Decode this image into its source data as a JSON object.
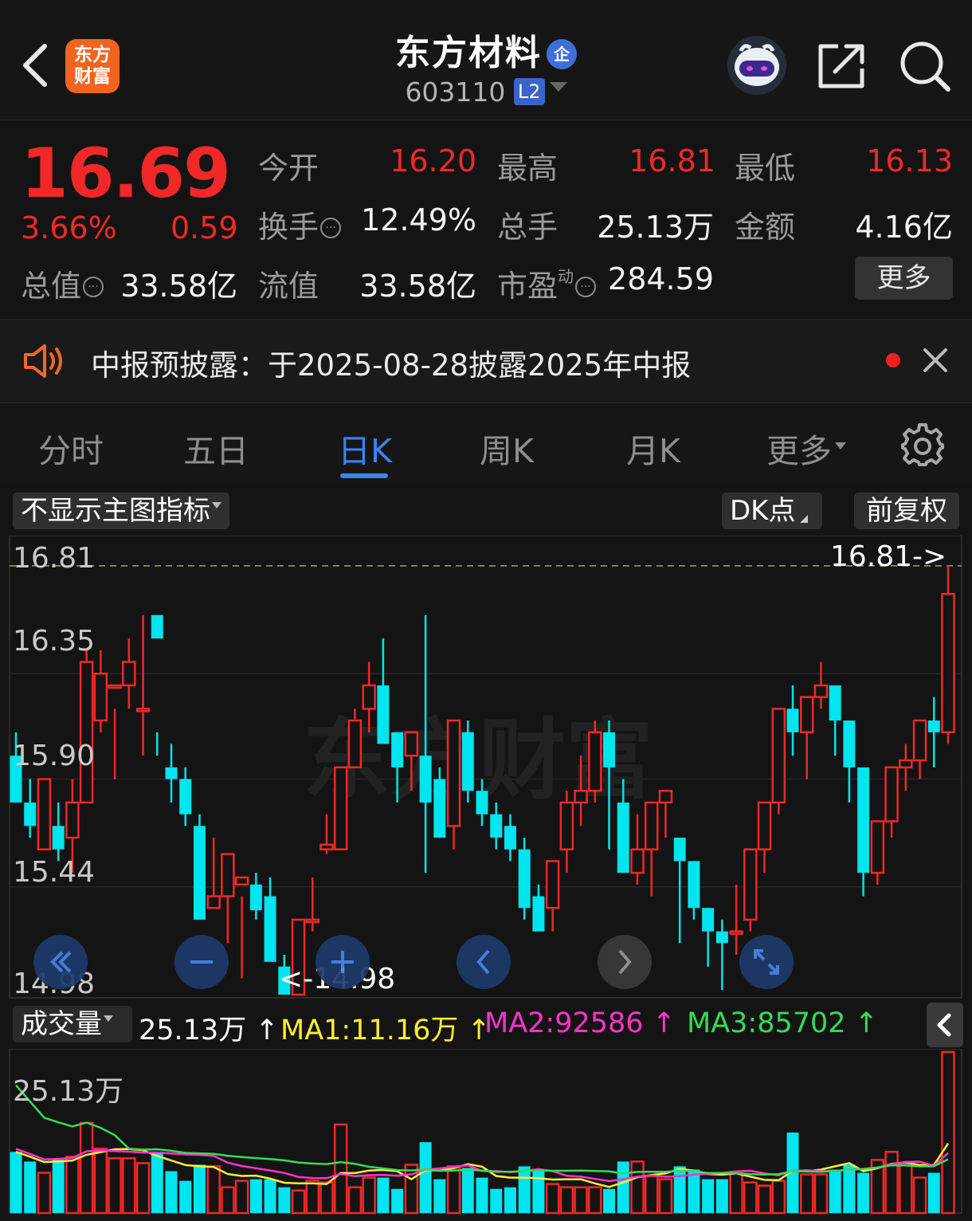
{
  "header": {
    "logo_line1": "东方",
    "logo_line2": "财富",
    "stock_name": "东方材料",
    "name_badge": "企",
    "stock_code": "603110",
    "level_badge": "L2"
  },
  "quote": {
    "price": "16.69",
    "change_pct": "3.66%",
    "change_amt": "0.59",
    "open_label": "今开",
    "open_value": "16.20",
    "high_label": "最高",
    "high_value": "16.81",
    "low_label": "最低",
    "low_value": "16.13",
    "turnover_label": "换手",
    "turnover_value": "12.49%",
    "volume_label": "总手",
    "volume_value": "25.13万",
    "amount_label": "金额",
    "amount_value": "4.16亿",
    "mcap_label": "总值",
    "mcap_value": "33.58亿",
    "float_label": "流值",
    "float_value": "33.58亿",
    "pe_label": "市盈",
    "pe_super": "动",
    "pe_value": "284.59",
    "more_label": "更多"
  },
  "notice": {
    "text": "中报预披露：于2025-08-28披露2025年中报"
  },
  "tabs": {
    "items": [
      "分时",
      "五日",
      "日K",
      "周K",
      "月K",
      "更多"
    ],
    "active": 2
  },
  "chart_controls": {
    "indicator_label": "不显示主图指标",
    "dk_label": "DK点",
    "adjust_label": "前复权"
  },
  "chart_data": {
    "type": "candlestick",
    "y_ticks": [
      "16.81",
      "16.35",
      "15.90",
      "15.44",
      "14.98"
    ],
    "ylim": [
      14.98,
      16.81
    ],
    "high_marker": "16.81->",
    "low_marker": "<-14.98",
    "watermark": "东方财富",
    "colors": {
      "up": "#f02828",
      "down": "#00e5ee",
      "ma1": "#ffee33",
      "ma2": "#ff33cc",
      "ma3": "#33dd55"
    },
    "candles": [
      [
        16.0,
        16.1,
        15.8,
        15.8
      ],
      [
        15.8,
        15.9,
        15.65,
        15.7
      ],
      [
        15.6,
        15.9,
        15.6,
        15.9
      ],
      [
        15.7,
        15.8,
        15.55,
        15.6
      ],
      [
        15.65,
        15.9,
        15.5,
        15.8
      ],
      [
        15.8,
        16.45,
        15.8,
        16.4
      ],
      [
        16.15,
        16.45,
        16.1,
        16.35
      ],
      [
        16.3,
        16.2,
        15.9,
        16.3
      ],
      [
        16.3,
        16.5,
        16.2,
        16.4
      ],
      [
        16.2,
        16.6,
        16.0,
        16.2
      ],
      [
        16.6,
        16.0,
        16.1,
        16.5
      ],
      [
        15.95,
        16.05,
        15.8,
        15.9
      ],
      [
        15.9,
        15.95,
        15.7,
        15.75
      ],
      [
        15.7,
        15.75,
        15.35,
        15.3
      ],
      [
        15.35,
        15.65,
        15.35,
        15.4
      ],
      [
        15.4,
        15.58,
        15.2,
        15.58
      ],
      [
        15.45,
        15.4,
        15.05,
        15.48
      ],
      [
        15.45,
        15.5,
        15.3,
        15.34
      ],
      [
        15.4,
        15.48,
        15.25,
        15.12
      ],
      [
        15.1,
        15.15,
        14.98,
        14.98
      ],
      [
        14.98,
        15.3,
        14.98,
        15.3
      ],
      [
        15.3,
        15.48,
        15.25,
        15.3
      ],
      [
        15.6,
        15.75,
        15.58,
        15.62
      ],
      [
        15.6,
        15.9,
        15.6,
        15.95
      ],
      [
        15.95,
        16.2,
        15.95,
        16.15
      ],
      [
        16.2,
        16.4,
        16.1,
        16.3
      ],
      [
        16.3,
        16.5,
        16.2,
        16.05
      ],
      [
        16.1,
        16.1,
        15.8,
        15.95
      ],
      [
        16.0,
        16.05,
        15.85,
        16.1
      ],
      [
        16.0,
        16.6,
        15.5,
        15.8
      ],
      [
        15.9,
        15.95,
        15.7,
        15.65
      ],
      [
        15.7,
        15.9,
        15.6,
        16.15
      ],
      [
        16.1,
        16.15,
        15.8,
        15.85
      ],
      [
        15.85,
        15.9,
        15.7,
        15.75
      ],
      [
        15.75,
        15.8,
        15.6,
        15.65
      ],
      [
        15.7,
        15.75,
        15.55,
        15.6
      ],
      [
        15.6,
        15.65,
        15.3,
        15.35
      ],
      [
        15.4,
        15.45,
        15.3,
        15.25
      ],
      [
        15.35,
        15.45,
        15.25,
        15.55
      ],
      [
        15.6,
        15.85,
        15.5,
        15.8
      ],
      [
        15.8,
        16.0,
        15.7,
        15.85
      ],
      [
        15.85,
        16.15,
        15.8,
        16.1
      ],
      [
        16.1,
        16.15,
        15.6,
        15.95
      ],
      [
        15.8,
        15.9,
        15.5,
        15.5
      ],
      [
        15.5,
        15.75,
        15.45,
        15.6
      ],
      [
        15.6,
        15.8,
        15.4,
        15.8
      ],
      [
        15.8,
        15.85,
        15.65,
        15.85
      ],
      [
        15.65,
        15.6,
        15.2,
        15.55
      ],
      [
        15.55,
        15.55,
        15.3,
        15.35
      ],
      [
        15.35,
        15.35,
        15.1,
        15.25
      ],
      [
        15.25,
        15.3,
        15.0,
        15.2
      ],
      [
        15.25,
        15.45,
        15.15,
        15.25
      ],
      [
        15.3,
        15.6,
        15.25,
        15.6
      ],
      [
        15.6,
        15.8,
        15.5,
        15.8
      ],
      [
        15.8,
        16.15,
        15.75,
        16.2
      ],
      [
        16.2,
        16.3,
        16.0,
        16.1
      ],
      [
        16.1,
        16.2,
        15.9,
        16.25
      ],
      [
        16.25,
        16.4,
        16.2,
        16.3
      ],
      [
        16.3,
        16.25,
        16.0,
        16.15
      ],
      [
        16.15,
        16.1,
        15.8,
        15.95
      ],
      [
        15.95,
        15.9,
        15.4,
        15.5
      ],
      [
        15.5,
        15.7,
        15.45,
        15.72
      ],
      [
        15.72,
        15.95,
        15.65,
        15.95
      ],
      [
        15.95,
        16.05,
        15.85,
        15.98
      ],
      [
        15.98,
        16.15,
        15.9,
        16.15
      ],
      [
        16.15,
        16.25,
        15.95,
        16.1
      ],
      [
        16.1,
        16.81,
        16.05,
        16.69
      ]
    ],
    "volume": {
      "label": "成交量",
      "value": "25.13万",
      "ma1": "MA1:11.16万",
      "ma2": "MA2:92586",
      "ma3": "MA3:85702",
      "arrow": "↑",
      "top_label": "25.13万",
      "bars": [
        0.38,
        0.32,
        0.25,
        0.33,
        0.35,
        0.56,
        0.4,
        0.34,
        0.34,
        0.31,
        0.38,
        0.26,
        0.2,
        0.3,
        0.29,
        0.16,
        0.2,
        0.21,
        0.21,
        0.16,
        0.14,
        0.2,
        0.19,
        0.55,
        0.16,
        0.22,
        0.22,
        0.15,
        0.3,
        0.44,
        0.21,
        0.29,
        0.28,
        0.22,
        0.15,
        0.16,
        0.29,
        0.26,
        0.18,
        0.16,
        0.16,
        0.16,
        0.15,
        0.32,
        0.32,
        0.23,
        0.21,
        0.29,
        0.27,
        0.21,
        0.21,
        0.25,
        0.19,
        0.17,
        0.2,
        0.5,
        0.24,
        0.24,
        0.27,
        0.3,
        0.25,
        0.33,
        0.38,
        0.31,
        0.22,
        0.25,
        1.0
      ]
    }
  }
}
